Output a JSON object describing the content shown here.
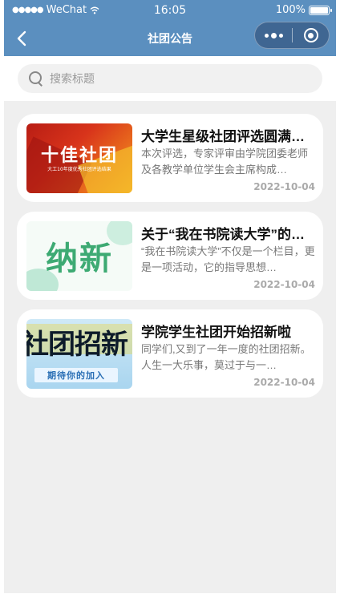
{
  "status_bar": {
    "carrier": "WeChat",
    "time": "16:05",
    "battery": "100%"
  },
  "nav": {
    "title": "社团公告",
    "back_icon": "chevron-left-icon",
    "more_icon": "more-dots-icon",
    "close_icon": "target-close-icon"
  },
  "search": {
    "placeholder": "搜索标题",
    "value": ""
  },
  "notices": [
    {
      "title": "大学生星级社团评选圆满结束",
      "desc": "本次评选，专家评审由学院团委老师及各教学单位学生会主席构成…",
      "date": "2022-10-04",
      "thumb_text": "十佳社团",
      "thumb_subtext": "大工10年度优秀社团评选结果"
    },
    {
      "title": "关于“我在书院读大学”的说明",
      "desc": "“我在书院读大学”不仅是一个栏目，更是一项活动，它的指导思想…",
      "date": "2022-10-04",
      "thumb_text": "纳新"
    },
    {
      "title": "学院学生社团开始招新啦",
      "desc": "同学们,又到了一年一度的社团招新。人生一大乐事，莫过于与一…",
      "date": "2022-10-04",
      "thumb_text": "社团招新",
      "thumb_subtext": "期待你的加入"
    }
  ],
  "colors": {
    "nav_bg": "#5b8fbf",
    "page_bg": "#efefef",
    "card_bg": "#ffffff"
  }
}
